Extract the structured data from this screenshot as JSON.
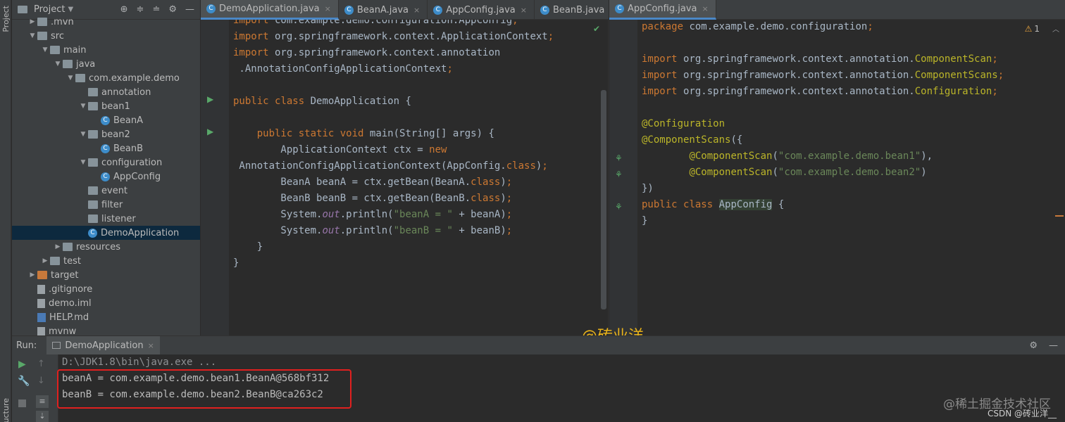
{
  "left_strip": {
    "project_label": "Project",
    "structure_label": "ucture"
  },
  "project": {
    "title": "Project",
    "tree": [
      {
        "label": ".mvn",
        "icon": "folder"
      },
      {
        "label": "src",
        "icon": "folder"
      },
      {
        "label": "main",
        "icon": "folder"
      },
      {
        "label": "java",
        "icon": "folder"
      },
      {
        "label": "com.example.demo",
        "icon": "package"
      },
      {
        "label": "annotation",
        "icon": "package"
      },
      {
        "label": "bean1",
        "icon": "package"
      },
      {
        "label": "BeanA",
        "icon": "class"
      },
      {
        "label": "bean2",
        "icon": "package"
      },
      {
        "label": "BeanB",
        "icon": "class"
      },
      {
        "label": "configuration",
        "icon": "package"
      },
      {
        "label": "AppConfig",
        "icon": "class"
      },
      {
        "label": "event",
        "icon": "package"
      },
      {
        "label": "filter",
        "icon": "package"
      },
      {
        "label": "listener",
        "icon": "package"
      },
      {
        "label": "DemoApplication",
        "icon": "class"
      },
      {
        "label": "resources",
        "icon": "folder"
      },
      {
        "label": "test",
        "icon": "folder"
      },
      {
        "label": "target",
        "icon": "folder"
      },
      {
        "label": ".gitignore",
        "icon": "file"
      },
      {
        "label": "demo.iml",
        "icon": "file"
      },
      {
        "label": "HELP.md",
        "icon": "md"
      },
      {
        "label": "mvnw",
        "icon": "file"
      }
    ]
  },
  "tabs_left": [
    {
      "label": "DemoApplication.java",
      "active": true
    },
    {
      "label": "BeanA.java",
      "active": false
    },
    {
      "label": "AppConfig.java",
      "active": false
    },
    {
      "label": "BeanB.java",
      "active": false
    }
  ],
  "tabs_right": [
    {
      "label": "AppConfig.java",
      "active": true
    }
  ],
  "editor_left": {
    "lines": [
      "import com.example.demo.configuration.AppConfig;",
      "import org.springframework.context.ApplicationContext;",
      "import org.springframework.context.annotation",
      " .AnnotationConfigApplicationContext;",
      "",
      "public class DemoApplication {",
      "",
      "    public static void main(String[] args) {",
      "        ApplicationContext ctx = new",
      " AnnotationConfigApplicationContext(AppConfig.class);",
      "        BeanA beanA = ctx.getBean(BeanA.class);",
      "        BeanB beanB = ctx.getBean(BeanB.class);",
      "        System.out.println(\"beanA = \" + beanA);",
      "        System.out.println(\"beanB = \" + beanB);",
      "    }",
      "}"
    ]
  },
  "editor_right": {
    "warning_count": "1",
    "lines": [
      "package com.example.demo.configuration;",
      "",
      "import org.springframework.context.annotation.ComponentScan;",
      "import org.springframework.context.annotation.ComponentScans;",
      "import org.springframework.context.annotation.Configuration;",
      "",
      "@Configuration",
      "@ComponentScans({",
      "        @ComponentScan(\"com.example.demo.bean1\"),",
      "        @ComponentScan(\"com.example.demo.bean2\")",
      "})",
      "public class AppConfig {",
      "}"
    ]
  },
  "watermark": "@砖业洋__",
  "run": {
    "label": "Run:",
    "tab_label": "DemoApplication",
    "output": [
      "D:\\JDK1.8\\bin\\java.exe ...",
      "beanA = com.example.demo.bean1.BeanA@568bf312",
      "beanB = com.example.demo.bean2.BeanB@ca263c2"
    ]
  },
  "footer_watermark_1": "@稀土掘金技术社区",
  "footer_watermark_2": "CSDN @砖业洋__",
  "colors": {
    "keyword": "#cc7832",
    "string": "#6a8759",
    "annotation": "#bbb529",
    "highlight_box": "#e0201f",
    "accent": "#4a88c7"
  }
}
